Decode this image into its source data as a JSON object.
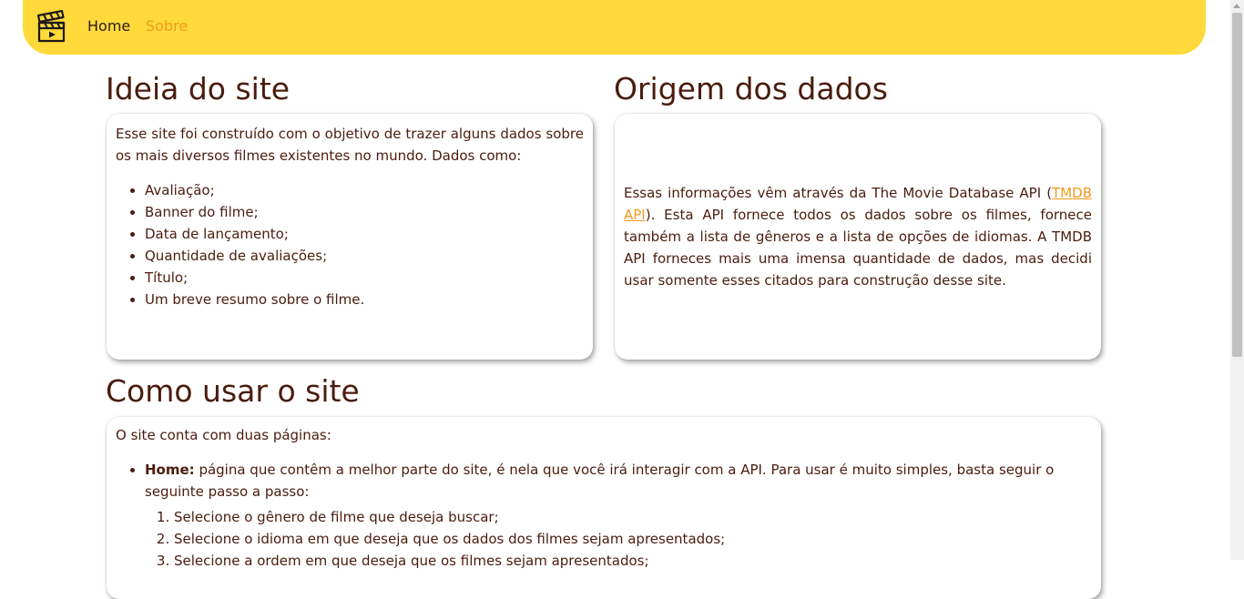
{
  "nav": {
    "home": "Home",
    "sobre": "Sobre"
  },
  "ideia": {
    "title": "Ideia do site",
    "intro": "Esse site foi construído com o objetivo de trazer alguns dados sobre os mais diversos filmes existentes no mundo. Dados como:",
    "items": [
      "Avaliação;",
      "Banner do filme;",
      "Data de lançamento;",
      "Quantidade de avaliações;",
      "Título;",
      "Um breve resumo sobre o filme."
    ]
  },
  "origem": {
    "title": "Origem dos dados",
    "text_before": "Essas informações vêm através da The Movie Database API (",
    "link": "TMDB API",
    "text_after": "). Esta API fornece todos os dados sobre os filmes, fornece também a lista de gêneros e a lista de opções de idiomas. A TMDB API forneces mais uma imensa quantidade de dados, mas decidi usar somente esses citados para construção desse site."
  },
  "como": {
    "title": "Como usar o site",
    "intro": "O site conta com duas páginas:",
    "home_label": "Home:",
    "home_text": " página que contêm a melhor parte do site, é nela que você irá interagir com a API. Para usar é muito simples, basta seguir o seguinte passo a passo:",
    "steps": [
      "Selecione o gênero de filme que deseja buscar;",
      "Selecione o idioma em que deseja que os dados dos filmes sejam apresentados;",
      "Selecione a ordem em que deseja que os filmes sejam apresentados;"
    ]
  },
  "colors": {
    "navbar": "#ffda3a",
    "accent": "#f39a1b",
    "text": "#4a1c0d"
  },
  "icons": {
    "logo": "clapperboard-icon"
  }
}
